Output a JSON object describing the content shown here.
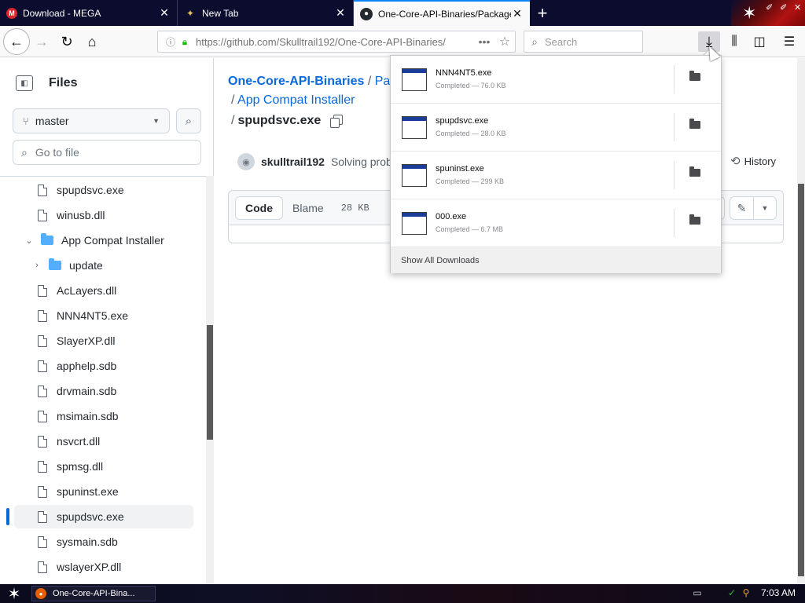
{
  "browser": {
    "tabs": [
      {
        "title": "Download - MEGA",
        "favicon": "mega-icon"
      },
      {
        "title": "New Tab",
        "favicon": "new-tab-icon"
      },
      {
        "title": "One-Core-API-Binaries/Packages/",
        "favicon": "github-icon"
      }
    ],
    "url": "https://github.com/Skulltrail192/One-Core-API-Binaries/",
    "search_placeholder": "Search"
  },
  "sidebar": {
    "title": "Files",
    "branch": "master",
    "goto_placeholder": "Go to file",
    "tree": [
      {
        "label": "spupdsvc.exe",
        "type": "file",
        "depth": 1
      },
      {
        "label": "winusb.dll",
        "type": "file",
        "depth": 1
      },
      {
        "label": "App Compat Installer",
        "type": "folder",
        "depth": 0,
        "expanded": true
      },
      {
        "label": "update",
        "type": "folder",
        "depth": 1,
        "expanded": false
      },
      {
        "label": "AcLayers.dll",
        "type": "file",
        "depth": 1
      },
      {
        "label": "NNN4NT5.exe",
        "type": "file",
        "depth": 1
      },
      {
        "label": "SlayerXP.dll",
        "type": "file",
        "depth": 1
      },
      {
        "label": "apphelp.sdb",
        "type": "file",
        "depth": 1
      },
      {
        "label": "drvmain.sdb",
        "type": "file",
        "depth": 1
      },
      {
        "label": "msimain.sdb",
        "type": "file",
        "depth": 1
      },
      {
        "label": "nsvcrt.dll",
        "type": "file",
        "depth": 1
      },
      {
        "label": "spmsg.dll",
        "type": "file",
        "depth": 1
      },
      {
        "label": "spuninst.exe",
        "type": "file",
        "depth": 1
      },
      {
        "label": "spupdsvc.exe",
        "type": "file",
        "depth": 1,
        "active": true
      },
      {
        "label": "sysmain.sdb",
        "type": "file",
        "depth": 1
      },
      {
        "label": "wslayerXP.dll",
        "type": "file",
        "depth": 1
      }
    ]
  },
  "main": {
    "breadcrumb_repo": "One-Core-API-Binaries",
    "breadcrumb_partial": "Pac",
    "breadcrumb_folder": "App Compat Installer",
    "file_name": "spupdsvc.exe",
    "commit_author": "skulltrail192",
    "commit_message": "Solving prob",
    "history_label": "History",
    "code_tab": "Code",
    "blame_tab": "Blame",
    "file_size": "28 KB",
    "sep": "/"
  },
  "downloads": {
    "items": [
      {
        "name": "NNN4NT5.exe",
        "status": "Completed — 76.0 KB"
      },
      {
        "name": "spupdsvc.exe",
        "status": "Completed — 28.0 KB"
      },
      {
        "name": "spuninst.exe",
        "status": "Completed — 299 KB"
      },
      {
        "name": "000.exe",
        "status": "Completed — 6.7 MB"
      }
    ],
    "footer": "Show All Downloads"
  },
  "taskbar": {
    "window_title": "One-Core-API-Bina...",
    "clock": "7:03 AM"
  }
}
